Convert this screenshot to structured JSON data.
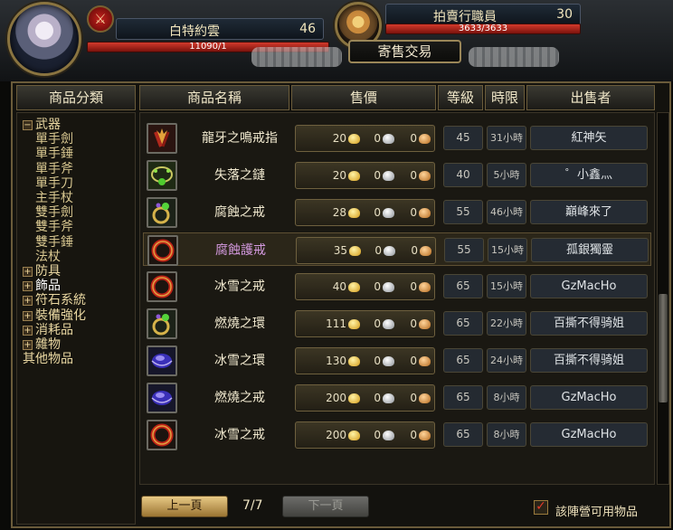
{
  "header": {
    "player_name": "白特約雲",
    "player_level": "46",
    "player_hp": "11090/1",
    "npc_name": "拍賣行職員",
    "npc_level": "30",
    "npc_hp": "3633/3633",
    "window_title": "寄售交易"
  },
  "columns": {
    "category": "商品分類",
    "name": "商品名稱",
    "price": "售價",
    "level": "等級",
    "time": "時限",
    "seller": "出售者"
  },
  "categories": [
    {
      "label": "武器",
      "toggle": "−",
      "level": 0
    },
    {
      "label": "單手劍",
      "level": 1
    },
    {
      "label": "單手錘",
      "level": 1
    },
    {
      "label": "單手斧",
      "level": 1
    },
    {
      "label": "單手刀",
      "level": 1
    },
    {
      "label": "主手杖",
      "level": 1
    },
    {
      "label": "雙手劍",
      "level": 1
    },
    {
      "label": "雙手斧",
      "level": 1
    },
    {
      "label": "雙手錘",
      "level": 1
    },
    {
      "label": "法杖",
      "level": 1
    },
    {
      "label": "防具",
      "toggle": "+",
      "level": 0
    },
    {
      "label": "飾品",
      "toggle": "+",
      "level": 0,
      "selected": true
    },
    {
      "label": "符石系統",
      "toggle": "+",
      "level": 0
    },
    {
      "label": "裝備強化",
      "toggle": "+",
      "level": 0
    },
    {
      "label": "消耗品",
      "toggle": "+",
      "level": 0
    },
    {
      "label": "雜物",
      "toggle": "+",
      "level": 0
    },
    {
      "label": "其他物品",
      "level": 0
    }
  ],
  "items": [
    {
      "name": "龍牙之鳴戒指",
      "icon": "fang-ring-icon",
      "gold": "20",
      "silver": "0",
      "copper": "0",
      "level": "45",
      "time": "31小時",
      "seller": "紅神矢",
      "name_color": "white"
    },
    {
      "name": "失落之鏈",
      "icon": "emerald-chain-icon",
      "gold": "20",
      "silver": "0",
      "copper": "0",
      "level": "40",
      "time": "5小時",
      "seller": "゜小鑫灬",
      "name_color": "white"
    },
    {
      "name": "腐蝕之戒",
      "icon": "green-gem-ring-icon",
      "gold": "28",
      "silver": "0",
      "copper": "0",
      "level": "55",
      "time": "46小時",
      "seller": "巔峰來了",
      "name_color": "white"
    },
    {
      "name": "腐蝕護戒",
      "icon": "red-ring-icon",
      "gold": "35",
      "silver": "0",
      "copper": "0",
      "level": "55",
      "time": "15小時",
      "seller": "孤銀獨靈",
      "name_color": "purple"
    },
    {
      "name": "冰雪之戒",
      "icon": "red-ring-icon",
      "gold": "40",
      "silver": "0",
      "copper": "0",
      "level": "65",
      "time": "15小時",
      "seller": "GzMacHo",
      "name_color": "white"
    },
    {
      "name": "燃燒之環",
      "icon": "green-gem-ring-icon",
      "gold": "111",
      "silver": "0",
      "copper": "0",
      "level": "65",
      "time": "22小時",
      "seller": "百撕不得骑姐",
      "name_color": "white"
    },
    {
      "name": "冰雪之環",
      "icon": "blue-gem-icon",
      "gold": "130",
      "silver": "0",
      "copper": "0",
      "level": "65",
      "time": "24小時",
      "seller": "百撕不得骑姐",
      "name_color": "white"
    },
    {
      "name": "燃燒之戒",
      "icon": "blue-gem-icon",
      "gold": "200",
      "silver": "0",
      "copper": "0",
      "level": "65",
      "time": "8小時",
      "seller": "GzMacHo",
      "name_color": "white"
    },
    {
      "name": "冰雪之戒",
      "icon": "red-ring-icon",
      "gold": "200",
      "silver": "0",
      "copper": "0",
      "level": "65",
      "time": "8小時",
      "seller": "GzMacHo",
      "name_color": "white"
    }
  ],
  "footer": {
    "prev_label": "上一頁",
    "next_label": "下一頁",
    "page_info": "7/7",
    "faction_checkbox_label": "該陣營可用物品",
    "faction_checked": true
  }
}
